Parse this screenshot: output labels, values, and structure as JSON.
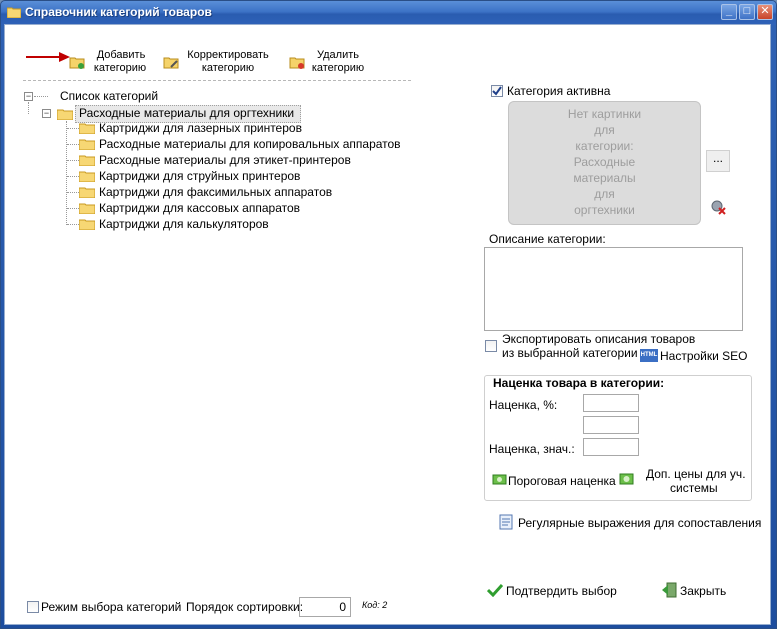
{
  "window": {
    "title": "Справочник категорий товаров",
    "minimize": "_",
    "maximize": "□",
    "close": "✕"
  },
  "toolbar": {
    "add_line1": "Добавить",
    "add_line2": "категорию",
    "edit_line1": "Корректировать",
    "edit_line2": "категорию",
    "delete_line1": "Удалить",
    "delete_line2": "категорию"
  },
  "tree": {
    "root": "Список категорий",
    "parent": "Расходные материалы для оргтехники",
    "children": [
      "Картриджи для лазерных принтеров",
      "Расходные материалы для копировальных аппаратов",
      "Расходные материалы для этикет-принтеров",
      "Картриджи для струйных принтеров",
      "Картриджи для факсимильных аппаратов",
      "Картриджи для кассовых аппаратов",
      "Картриджи для калькуляторов"
    ]
  },
  "details": {
    "active_label": "Категория активна",
    "active_checked": true,
    "image_lines": [
      "Нет картинки",
      "для",
      "категории:",
      "Расходные",
      "материалы",
      "для",
      "оргтехники"
    ],
    "browse_label": "...",
    "description_label": "Описание категории:",
    "description_value": "",
    "export_line1": "Экспортировать описания товаров",
    "export_line2": "из выбранной категории",
    "seo_label": "Настройки SEO",
    "seo_icon_text": "HTML"
  },
  "markup": {
    "title": "Наценка товара в категории:",
    "percent_label": "Наценка, %:",
    "value_label": "Наценка, знач.:",
    "percent_value": "",
    "percent_value2": "",
    "value_value": "",
    "threshold_label": "Пороговая наценка",
    "extra_line1": "Доп. цены для уч.",
    "extra_line2": "системы"
  },
  "regex_label": "Регулярные выражения для сопоставления",
  "footer": {
    "select_mode_label": "Режим выбора категорий",
    "sort_label": "Порядок сортировки:",
    "sort_value": "0",
    "code_label": "Код: 2",
    "confirm_label": "Подтвердить выбор",
    "close_label": "Закрыть"
  },
  "colors": {
    "title_bar": "#3c72c6",
    "client_bg": "#ffffff",
    "arrow": "#c00000",
    "check_green": "#2f9e2f"
  }
}
